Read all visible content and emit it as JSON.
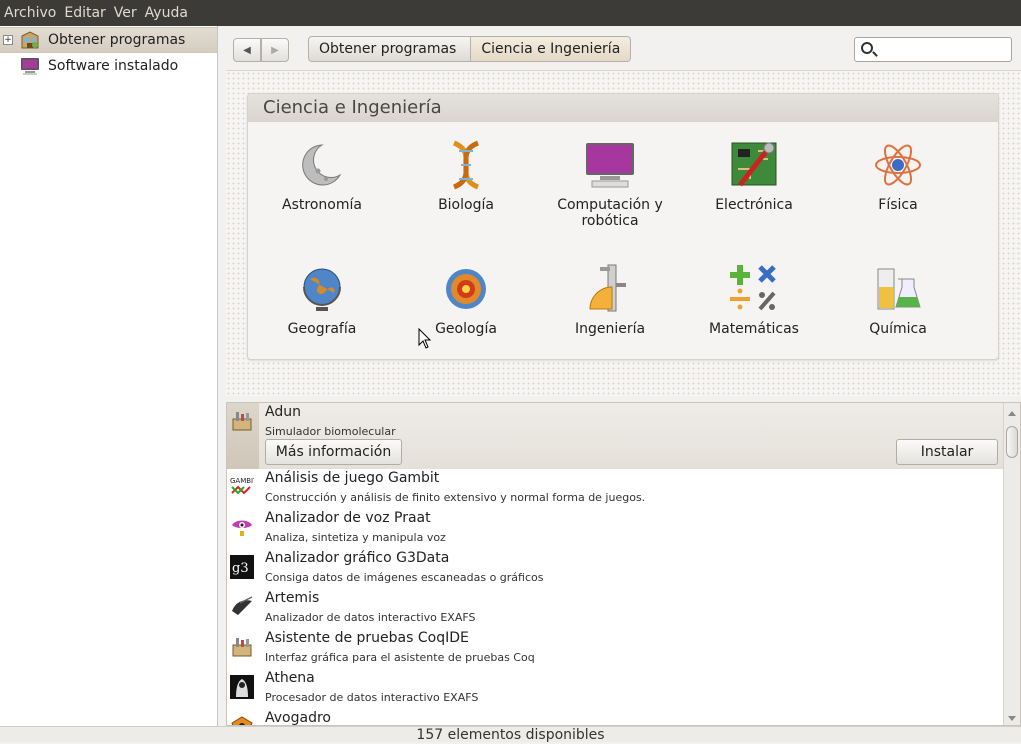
{
  "menubar": {
    "items": [
      "Archivo",
      "Editar",
      "Ver",
      "Ayuda"
    ]
  },
  "sidebar": {
    "items": [
      {
        "label": "Obtener programas",
        "icon": "get-software-icon",
        "expander": "+"
      },
      {
        "label": "Software instalado",
        "icon": "installed-software-icon"
      }
    ]
  },
  "toolbar": {
    "back_glyph": "◀",
    "forward_glyph": "▶",
    "breadcrumbs": [
      "Obtener programas",
      "Ciencia e Ingeniería"
    ],
    "search_placeholder": ""
  },
  "category_panel": {
    "title": "Ciencia e Ingeniería",
    "categories": [
      {
        "label": "Astronomía",
        "icon": "moon-icon"
      },
      {
        "label": "Biología",
        "icon": "dna-icon"
      },
      {
        "label": "Computación y robótica",
        "icon": "computer-icon"
      },
      {
        "label": "Electrónica",
        "icon": "circuit-board-icon"
      },
      {
        "label": "Física",
        "icon": "atom-icon"
      },
      {
        "label": "Geografía",
        "icon": "globe-icon"
      },
      {
        "label": "Geología",
        "icon": "earth-core-icon"
      },
      {
        "label": "Ingeniería",
        "icon": "caliper-icon"
      },
      {
        "label": "Matemáticas",
        "icon": "math-symbols-icon"
      },
      {
        "label": "Química",
        "icon": "beakers-icon"
      }
    ]
  },
  "apps": {
    "selected": {
      "name": "Adun",
      "description": "Simulador biomolecular",
      "more_info_label": "Más información",
      "install_label": "Instalar",
      "icon": "adun-icon"
    },
    "list": [
      {
        "name": "Análisis de juego Gambit",
        "description": "Construcción y análisis de finito extensivo y normal forma de juegos.",
        "icon": "gambit-icon"
      },
      {
        "name": "Analizador de voz Praat",
        "description": "Analiza, sintetiza y manipula voz",
        "icon": "praat-icon"
      },
      {
        "name": "Analizador gráfico G3Data",
        "description": "Consiga datos de imágenes escaneadas o gráficos",
        "icon": "g3data-icon"
      },
      {
        "name": "Artemis",
        "description": "Analizador de datos interactivo EXAFS",
        "icon": "artemis-icon"
      },
      {
        "name": "Asistente de pruebas CoqIDE",
        "description": "Interfaz gráfica para el asistente de pruebas Coq",
        "icon": "coqide-icon"
      },
      {
        "name": "Athena",
        "description": "Procesador de datos interactivo EXAFS",
        "icon": "athena-icon"
      },
      {
        "name": "Avogadro",
        "description": "",
        "icon": "avogadro-icon"
      }
    ]
  },
  "status": {
    "text": "157 elementos disponibles"
  }
}
